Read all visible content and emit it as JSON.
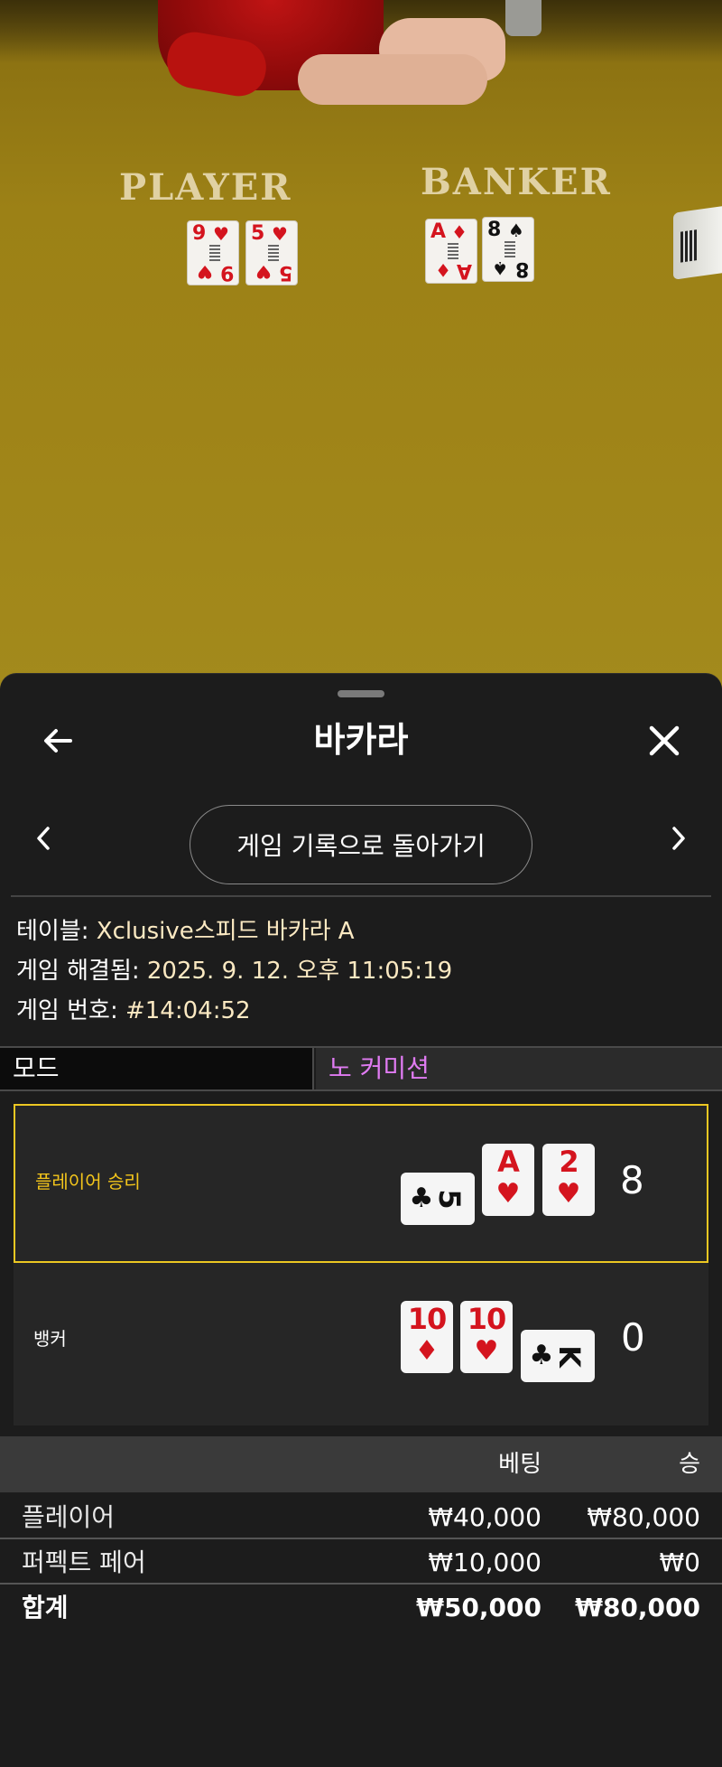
{
  "video": {
    "player_label": "PLAYER",
    "banker_label": "BANKER",
    "player_cards": [
      {
        "rank": "9",
        "suit": "♥",
        "color": "red"
      },
      {
        "rank": "5",
        "suit": "♥",
        "color": "red"
      }
    ],
    "banker_cards": [
      {
        "rank": "A",
        "suit": "♦",
        "color": "red"
      },
      {
        "rank": "8",
        "suit": "♠",
        "color": "blk"
      }
    ]
  },
  "sheet": {
    "back_icon": "arrow-left-icon",
    "title": "바카라",
    "close_icon": "close-icon",
    "prev_icon": "chevron-left-icon",
    "next_icon": "chevron-right-icon",
    "back_to_history": "게임 기록으로 돌아가기"
  },
  "info": {
    "table_label": "테이블: ",
    "table_value": "Xclusive스피드 바카라 A",
    "resolved_label": "게임 해결됨: ",
    "resolved_value": "2025. 9. 12. 오후 11:05:19",
    "number_label": "게임 번호: ",
    "number_value": "#14:04:52"
  },
  "mode": {
    "label": "모드",
    "value": "노 커미션"
  },
  "outcome": {
    "player": {
      "label": "플레이어 승리",
      "score": "8",
      "cards": [
        {
          "rank": "5",
          "suit": "♣",
          "color": "blk",
          "orientation": "side"
        },
        {
          "rank": "A",
          "suit": "♥",
          "color": "red",
          "orientation": "up"
        },
        {
          "rank": "2",
          "suit": "♥",
          "color": "red",
          "orientation": "up"
        }
      ]
    },
    "banker": {
      "label": "뱅커",
      "score": "0",
      "cards": [
        {
          "rank": "10",
          "suit": "♦",
          "color": "red",
          "orientation": "up"
        },
        {
          "rank": "10",
          "suit": "♥",
          "color": "red",
          "orientation": "up"
        },
        {
          "rank": "K",
          "suit": "♣",
          "color": "blk",
          "orientation": "side"
        }
      ]
    }
  },
  "bets": {
    "headers": {
      "bet": "베팅",
      "win": "승"
    },
    "rows": [
      {
        "name": "플레이어",
        "bet": "₩40,000",
        "win": "₩80,000"
      },
      {
        "name": "퍼펙트 페어",
        "bet": "₩10,000",
        "win": "₩0"
      }
    ],
    "total": {
      "name": "합계",
      "bet": "₩50,000",
      "win": "₩80,000"
    }
  },
  "colors": {
    "win_highlight": "#ecc722",
    "mode_value": "#e07bf2",
    "info_value": "#fbe9c2",
    "card_red": "#d4141e"
  }
}
